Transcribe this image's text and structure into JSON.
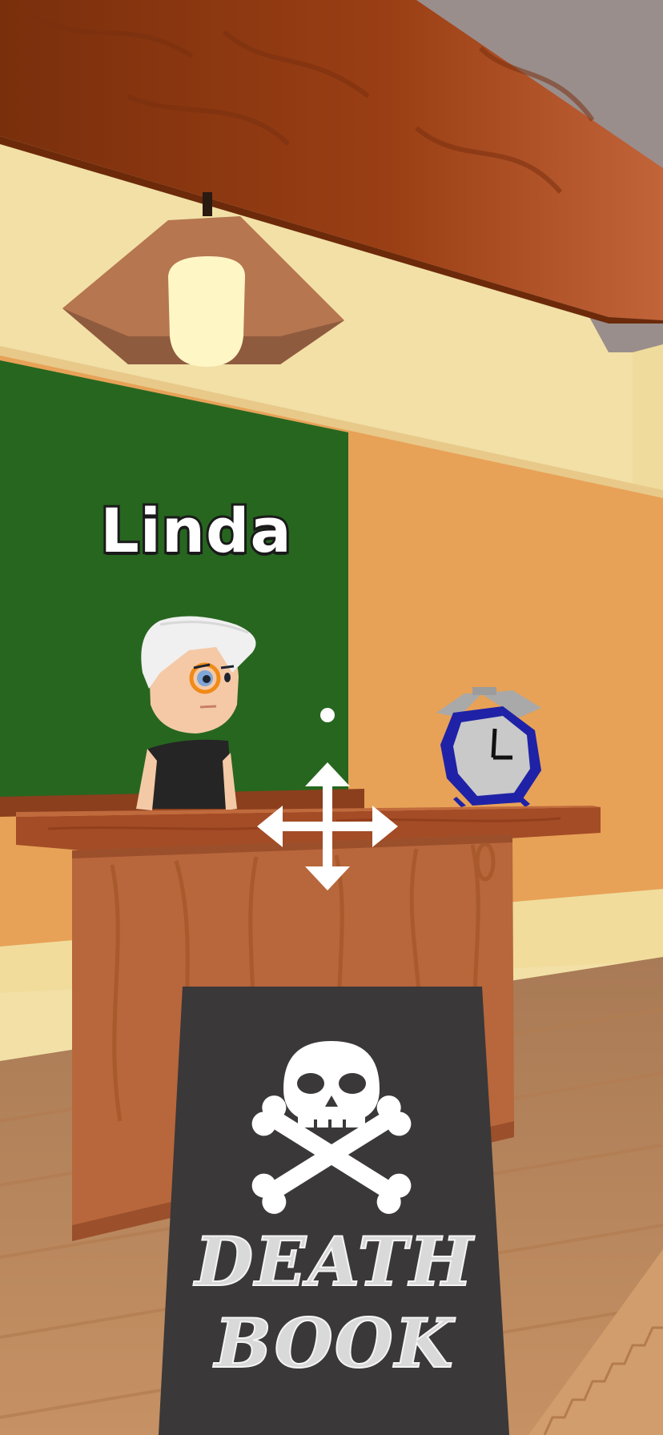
{
  "scene": {
    "character_name": "Linda",
    "death_book": {
      "title_line1": "DEATH",
      "title_line2": "BOOK",
      "icon": "skull-crossbones-icon"
    },
    "controls": {
      "move_icon": "move-arrows-icon",
      "crosshair": "crosshair-dot"
    },
    "props": [
      "ceiling-lamp",
      "alarm-clock",
      "reception-desk",
      "chalkboard"
    ],
    "alarm_clock_time": "12:15",
    "colors": {
      "ceiling_wood": "#9a3d13",
      "upper_wall": "#f2e1a6",
      "lower_wall": "#e8a356",
      "chalkboard": "#26661f",
      "desk_wood": "#b8663b",
      "floor": "#c68a58",
      "book_cover": "#3a3839",
      "clock_blue": "#1f22a6"
    }
  }
}
